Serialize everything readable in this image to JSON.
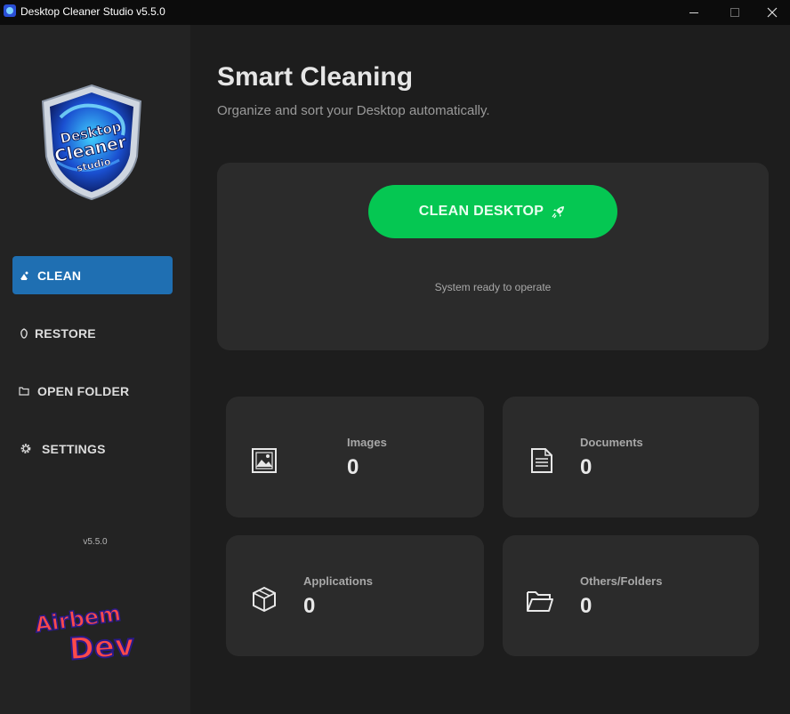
{
  "window": {
    "title": "Desktop Cleaner Studio v5.5.0",
    "controls": [
      "minimize",
      "maximize",
      "close"
    ]
  },
  "sidebar": {
    "logo_icon": "desktop-cleaner-studio-logo",
    "logo_text": "Desktop Cleaner studio",
    "items": [
      {
        "label": "CLEAN",
        "icon": "broom-icon",
        "active": true
      },
      {
        "label": "RESTORE",
        "icon": "restore-icon",
        "active": false
      },
      {
        "label": "OPEN FOLDER",
        "icon": "folder-icon",
        "active": false
      },
      {
        "label": "SETTINGS",
        "icon": "gear-icon",
        "active": false
      }
    ],
    "version": "v5.5.0",
    "dev_logo_text": "Airbem Dev"
  },
  "main": {
    "title": "Smart Cleaning",
    "subtitle": "Organize and sort your Desktop automatically.",
    "clean_button_label": "CLEAN DESKTOP",
    "clean_button_icon": "rocket-icon",
    "status": "System ready to operate",
    "stats": [
      {
        "label": "Images",
        "value": "0",
        "icon": "image-icon"
      },
      {
        "label": "Documents",
        "value": "0",
        "icon": "document-icon"
      },
      {
        "label": "Applications",
        "value": "0",
        "icon": "package-icon"
      },
      {
        "label": "Others/Folders",
        "value": "0",
        "icon": "folder-icon"
      }
    ]
  },
  "colors": {
    "background": "#1d1d1d",
    "sidebar": "#232323",
    "card": "#2b2b2b",
    "accent_blue": "#1f6fb2",
    "accent_green": "#05c752"
  }
}
